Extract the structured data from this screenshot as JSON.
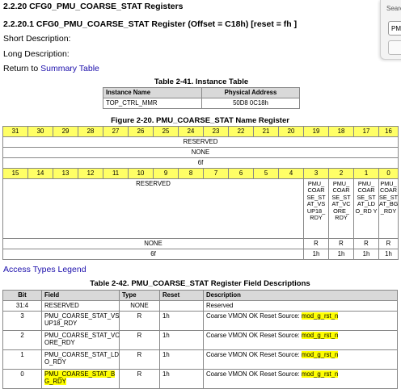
{
  "section_title": "2.2.20 CFG0_PMU_COARSE_STAT Registers",
  "register_title": "2.2.20.1 CFG0_PMU_COARSE_STAT Register (Offset = C18h) [reset = fh ]",
  "short_description": "Short Description:",
  "long_description": "Long Description:",
  "return_prefix": "Return to ",
  "return_link": "Summary Table",
  "instance_table": {
    "caption": "Table 2-41. Instance Table",
    "headers": [
      "Instance Name",
      "Physical Address"
    ],
    "rows": [
      [
        "TOP_CTRL_MMR",
        "50D8 0C18h"
      ]
    ]
  },
  "register_figure": {
    "caption": "Figure 2-20. PMU_COARSE_STAT Name Register",
    "upper_bits": [
      "31",
      "30",
      "29",
      "28",
      "27",
      "26",
      "25",
      "24",
      "23",
      "22",
      "21",
      "20",
      "19",
      "18",
      "17",
      "16"
    ],
    "upper_field": "RESERVED",
    "upper_type": "NONE",
    "upper_reset": "6f",
    "lower_bits": [
      "15",
      "14",
      "13",
      "12",
      "11",
      "10",
      "9",
      "8",
      "7",
      "6",
      "5",
      "4",
      "3",
      "2",
      "1",
      "0"
    ],
    "lower_field": "RESERVED",
    "lower_type": "NONE",
    "lower_reset": "6f",
    "bit_fields": [
      "PMU_ COAR SE_ST AT_VS UP18_ RDY",
      "PMU_ COAR SE_ST AT_VC ORE_ RDY",
      "PMU_ COAR SE_ST AT_LD O_RD Y",
      "PMU_ COAR SE_ST AT_BG _RDY"
    ],
    "bit_types": [
      "R",
      "R",
      "R",
      "R"
    ],
    "bit_resets": [
      "1h",
      "1h",
      "1h",
      "1h"
    ]
  },
  "access_types_link": "Access Types Legend",
  "field_table": {
    "caption": "Table 2-42. PMU_COARSE_STAT Register Field Descriptions",
    "headers": [
      "Bit",
      "Field",
      "Type",
      "Reset",
      "Description"
    ],
    "rows": [
      {
        "bit": "31:4",
        "field": "RESERVED",
        "type": "NONE",
        "reset": "",
        "desc": "Reserved",
        "signal": ""
      },
      {
        "bit": "3",
        "field": "PMU_COARSE_STAT_VS UP18_RDY",
        "type": "R",
        "reset": "1h",
        "desc": "Coarse VMON OK Reset Source: ",
        "signal": "mod_g_rst_n"
      },
      {
        "bit": "2",
        "field": "PMU_COARSE_STAT_VC ORE_RDY",
        "type": "R",
        "reset": "1h",
        "desc": "Coarse VMON OK Reset Source: ",
        "signal": "mod_g_rst_n"
      },
      {
        "bit": "1",
        "field": "PMU_COARSE_STAT_LD O_RDY",
        "type": "R",
        "reset": "1h",
        "desc": "Coarse VMON OK Reset Source: ",
        "signal": "mod_g_rst_n"
      },
      {
        "bit": "0",
        "field": "PMU_COARSE_STAT_B G_RDY",
        "type": "R",
        "reset": "1h",
        "desc": "Coarse VMON OK Reset Source: ",
        "signal": "mod_g_rst_n"
      }
    ]
  },
  "search": {
    "label": "Searc",
    "value": "PMU"
  },
  "colors": {
    "bit_header": "#ffff66",
    "highlight": "#ffff00",
    "table_header": "#d9d9d9",
    "link": "#1a0dab"
  }
}
